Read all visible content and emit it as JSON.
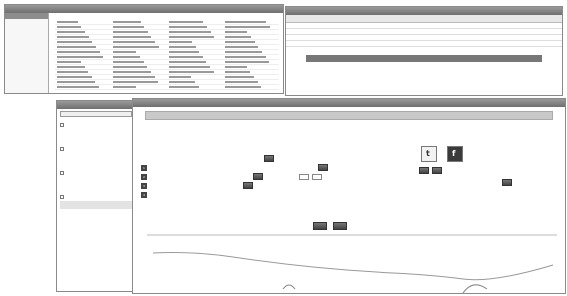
{
  "back_window_left": {
    "sidebar_title": "",
    "sidebar_items": [
      "",
      "",
      "",
      "",
      "",
      "",
      ""
    ],
    "grid_rows": 14
  },
  "back_window_right": {
    "title": ""
  },
  "tree_panel": {
    "title": "",
    "selector_value": "",
    "nodes": [
      {
        "label": "",
        "level": 0
      },
      {
        "label": "",
        "level": 1
      },
      {
        "label": "",
        "level": 1
      },
      {
        "label": "",
        "level": 0
      },
      {
        "label": "",
        "level": 1
      },
      {
        "label": "",
        "level": 1
      },
      {
        "label": "",
        "level": 0
      },
      {
        "label": "",
        "level": 1
      },
      {
        "label": "",
        "level": 1
      },
      {
        "label": "",
        "level": 0
      },
      {
        "label": "",
        "level": 1,
        "active": true
      },
      {
        "label": "",
        "level": 1
      }
    ]
  },
  "dialog": {
    "title": "",
    "notice": "",
    "left_heading": "",
    "right_heading": "",
    "steps": [
      "1",
      "2",
      "3",
      "4",
      "5"
    ],
    "right_sub_heading": "",
    "social_icons": [
      "twitter-icon",
      "facebook-icon"
    ],
    "footer_buttons": [
      "",
      ""
    ]
  },
  "colors": {
    "titlebar": "#6f6f6f",
    "dark_button": "#444444",
    "notice_bg": "#c9c9c9"
  }
}
